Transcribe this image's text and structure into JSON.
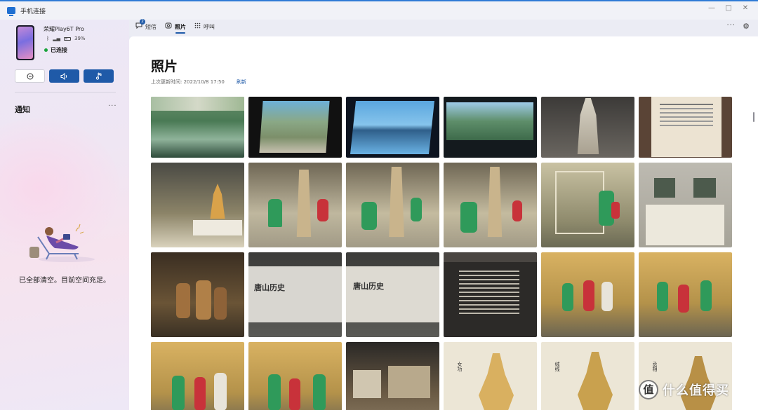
{
  "window": {
    "title": "手机连接",
    "controls": {
      "minimize": "—",
      "maximize": "□",
      "close": "✕"
    }
  },
  "device": {
    "name": "荣耀Play6T Pro",
    "battery": "39%",
    "status": "已连接"
  },
  "controls": {
    "dnd_icon": "minus-circle-icon",
    "volume_icon": "speaker-icon",
    "music_icon": "music-note-icon"
  },
  "notifications": {
    "title": "通知",
    "more": "···",
    "empty_text": "已全部清空。目前空间充足。"
  },
  "tabs": [
    {
      "label": "短信",
      "icon": "message-icon",
      "badge": "2"
    },
    {
      "label": "照片",
      "icon": "photo-icon",
      "selected": true
    },
    {
      "label": "呼叫",
      "icon": "dialpad-icon"
    }
  ],
  "toolbar": {
    "more": "···",
    "settings_icon": "gear-icon"
  },
  "photos_page": {
    "title": "照片",
    "last_updated": "上次更新时间: 2022/10/8 17:50",
    "refresh": "刷新"
  },
  "photo_labels": {
    "p15": "唐山历史",
    "p16": "唐山历史",
    "p22": "女功",
    "p23": "绒线",
    "p24": "丞相"
  },
  "photos": [
    {
      "id": "p1",
      "desc": "model-city"
    },
    {
      "id": "p2",
      "desc": "model-city-screen"
    },
    {
      "id": "p3",
      "desc": "lake-screen"
    },
    {
      "id": "p4",
      "desc": "city-screen"
    },
    {
      "id": "p5",
      "desc": "pagoda-exhibit"
    },
    {
      "id": "p6",
      "desc": "text-panel"
    },
    {
      "id": "p7",
      "desc": "pagoda-case"
    },
    {
      "id": "p8",
      "desc": "child-pagoda"
    },
    {
      "id": "p9",
      "desc": "children-pagoda"
    },
    {
      "id": "p10",
      "desc": "children-pagoda-2"
    },
    {
      "id": "p11",
      "desc": "child-case"
    },
    {
      "id": "p12",
      "desc": "bronze-vessel"
    },
    {
      "id": "p13",
      "desc": "figures-diorama"
    },
    {
      "id": "p14",
      "desc": "history-wall"
    },
    {
      "id": "p15",
      "desc": "history-wall-2"
    },
    {
      "id": "p16",
      "desc": "text-board"
    },
    {
      "id": "p17",
      "desc": "children-mural"
    },
    {
      "id": "p18",
      "desc": "children-mural-2"
    },
    {
      "id": "p19",
      "desc": "children-mural-3"
    },
    {
      "id": "p20",
      "desc": "children-mural-4"
    },
    {
      "id": "p21",
      "desc": "gallery-hall"
    },
    {
      "id": "p22",
      "desc": "shadow-puppet"
    },
    {
      "id": "p23",
      "desc": "shadow-puppet-2"
    },
    {
      "id": "p24",
      "desc": "shadow-puppet-3"
    }
  ],
  "watermark": {
    "logo": "值",
    "text": "什么值得买"
  }
}
